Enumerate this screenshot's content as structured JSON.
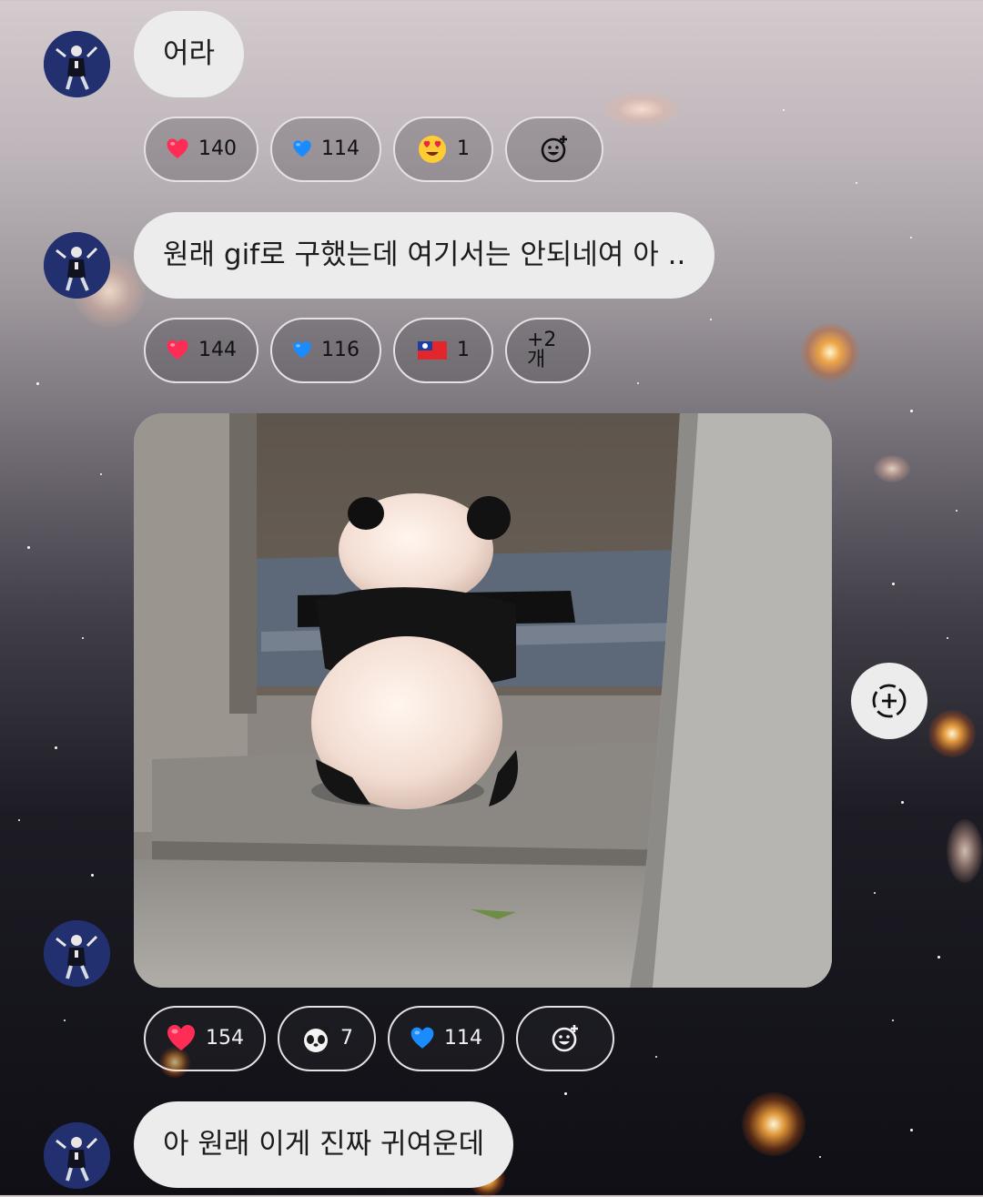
{
  "messages": [
    {
      "text": "어라",
      "reactions": [
        {
          "icon": "red-heart-icon",
          "count": "140"
        },
        {
          "icon": "blue-heart-icon",
          "count": "114"
        },
        {
          "icon": "heart-eyes-face-icon",
          "count": "1"
        },
        {
          "icon": "add-reaction-icon",
          "count": ""
        }
      ]
    },
    {
      "text": "원래 gif로 구했는데 여기서는 안되네여 아 ..",
      "reactions": [
        {
          "icon": "red-heart-icon",
          "count": "144"
        },
        {
          "icon": "blue-heart-icon",
          "count": "116"
        },
        {
          "icon": "taiwan-flag-icon",
          "count": "1"
        },
        {
          "icon": "more-reactions",
          "count": "+2개"
        }
      ]
    },
    {
      "image": "panda-cub-photo",
      "reactions": [
        {
          "icon": "red-heart-icon",
          "count": "154"
        },
        {
          "icon": "panda-face-icon",
          "count": "7"
        },
        {
          "icon": "blue-heart-icon",
          "count": "114"
        },
        {
          "icon": "add-reaction-icon",
          "count": ""
        }
      ]
    },
    {
      "text": "아 원래 이게 진짜 귀여운데"
    }
  ],
  "colors": {
    "bubble": "#ececec",
    "chip_border": "#e6e2e4",
    "avatar": "#263472"
  },
  "side_action": {
    "icon": "add-circle-dashed-icon"
  }
}
